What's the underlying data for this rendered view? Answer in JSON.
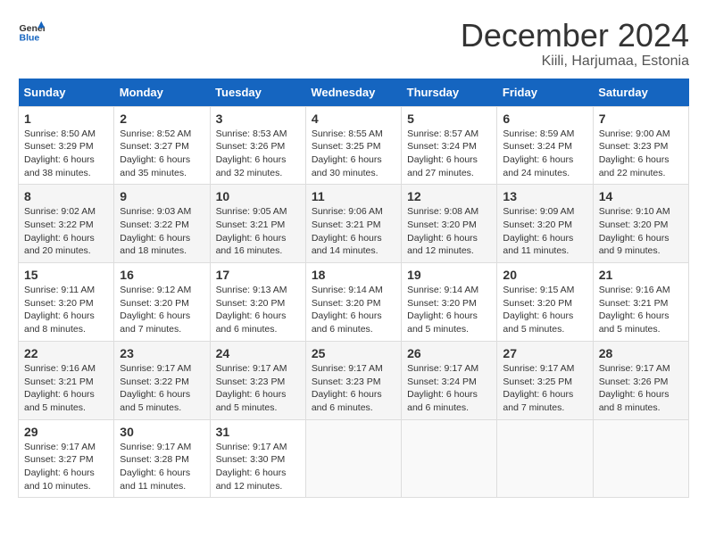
{
  "header": {
    "logo_line1": "General",
    "logo_line2": "Blue",
    "month": "December 2024",
    "location": "Kiili, Harjumaa, Estonia"
  },
  "weekdays": [
    "Sunday",
    "Monday",
    "Tuesday",
    "Wednesday",
    "Thursday",
    "Friday",
    "Saturday"
  ],
  "weeks": [
    [
      {
        "day": "1",
        "sunrise": "8:50 AM",
        "sunset": "3:29 PM",
        "daylight": "6 hours and 38 minutes."
      },
      {
        "day": "2",
        "sunrise": "8:52 AM",
        "sunset": "3:27 PM",
        "daylight": "6 hours and 35 minutes."
      },
      {
        "day": "3",
        "sunrise": "8:53 AM",
        "sunset": "3:26 PM",
        "daylight": "6 hours and 32 minutes."
      },
      {
        "day": "4",
        "sunrise": "8:55 AM",
        "sunset": "3:25 PM",
        "daylight": "6 hours and 30 minutes."
      },
      {
        "day": "5",
        "sunrise": "8:57 AM",
        "sunset": "3:24 PM",
        "daylight": "6 hours and 27 minutes."
      },
      {
        "day": "6",
        "sunrise": "8:59 AM",
        "sunset": "3:24 PM",
        "daylight": "6 hours and 24 minutes."
      },
      {
        "day": "7",
        "sunrise": "9:00 AM",
        "sunset": "3:23 PM",
        "daylight": "6 hours and 22 minutes."
      }
    ],
    [
      {
        "day": "8",
        "sunrise": "9:02 AM",
        "sunset": "3:22 PM",
        "daylight": "6 hours and 20 minutes."
      },
      {
        "day": "9",
        "sunrise": "9:03 AM",
        "sunset": "3:22 PM",
        "daylight": "6 hours and 18 minutes."
      },
      {
        "day": "10",
        "sunrise": "9:05 AM",
        "sunset": "3:21 PM",
        "daylight": "6 hours and 16 minutes."
      },
      {
        "day": "11",
        "sunrise": "9:06 AM",
        "sunset": "3:21 PM",
        "daylight": "6 hours and 14 minutes."
      },
      {
        "day": "12",
        "sunrise": "9:08 AM",
        "sunset": "3:20 PM",
        "daylight": "6 hours and 12 minutes."
      },
      {
        "day": "13",
        "sunrise": "9:09 AM",
        "sunset": "3:20 PM",
        "daylight": "6 hours and 11 minutes."
      },
      {
        "day": "14",
        "sunrise": "9:10 AM",
        "sunset": "3:20 PM",
        "daylight": "6 hours and 9 minutes."
      }
    ],
    [
      {
        "day": "15",
        "sunrise": "9:11 AM",
        "sunset": "3:20 PM",
        "daylight": "6 hours and 8 minutes."
      },
      {
        "day": "16",
        "sunrise": "9:12 AM",
        "sunset": "3:20 PM",
        "daylight": "6 hours and 7 minutes."
      },
      {
        "day": "17",
        "sunrise": "9:13 AM",
        "sunset": "3:20 PM",
        "daylight": "6 hours and 6 minutes."
      },
      {
        "day": "18",
        "sunrise": "9:14 AM",
        "sunset": "3:20 PM",
        "daylight": "6 hours and 6 minutes."
      },
      {
        "day": "19",
        "sunrise": "9:14 AM",
        "sunset": "3:20 PM",
        "daylight": "6 hours and 5 minutes."
      },
      {
        "day": "20",
        "sunrise": "9:15 AM",
        "sunset": "3:20 PM",
        "daylight": "6 hours and 5 minutes."
      },
      {
        "day": "21",
        "sunrise": "9:16 AM",
        "sunset": "3:21 PM",
        "daylight": "6 hours and 5 minutes."
      }
    ],
    [
      {
        "day": "22",
        "sunrise": "9:16 AM",
        "sunset": "3:21 PM",
        "daylight": "6 hours and 5 minutes."
      },
      {
        "day": "23",
        "sunrise": "9:17 AM",
        "sunset": "3:22 PM",
        "daylight": "6 hours and 5 minutes."
      },
      {
        "day": "24",
        "sunrise": "9:17 AM",
        "sunset": "3:23 PM",
        "daylight": "6 hours and 5 minutes."
      },
      {
        "day": "25",
        "sunrise": "9:17 AM",
        "sunset": "3:23 PM",
        "daylight": "6 hours and 6 minutes."
      },
      {
        "day": "26",
        "sunrise": "9:17 AM",
        "sunset": "3:24 PM",
        "daylight": "6 hours and 6 minutes."
      },
      {
        "day": "27",
        "sunrise": "9:17 AM",
        "sunset": "3:25 PM",
        "daylight": "6 hours and 7 minutes."
      },
      {
        "day": "28",
        "sunrise": "9:17 AM",
        "sunset": "3:26 PM",
        "daylight": "6 hours and 8 minutes."
      }
    ],
    [
      {
        "day": "29",
        "sunrise": "9:17 AM",
        "sunset": "3:27 PM",
        "daylight": "6 hours and 10 minutes."
      },
      {
        "day": "30",
        "sunrise": "9:17 AM",
        "sunset": "3:28 PM",
        "daylight": "6 hours and 11 minutes."
      },
      {
        "day": "31",
        "sunrise": "9:17 AM",
        "sunset": "3:30 PM",
        "daylight": "6 hours and 12 minutes."
      },
      null,
      null,
      null,
      null
    ]
  ],
  "labels": {
    "sunrise": "Sunrise:",
    "sunset": "Sunset:",
    "daylight": "Daylight:"
  }
}
